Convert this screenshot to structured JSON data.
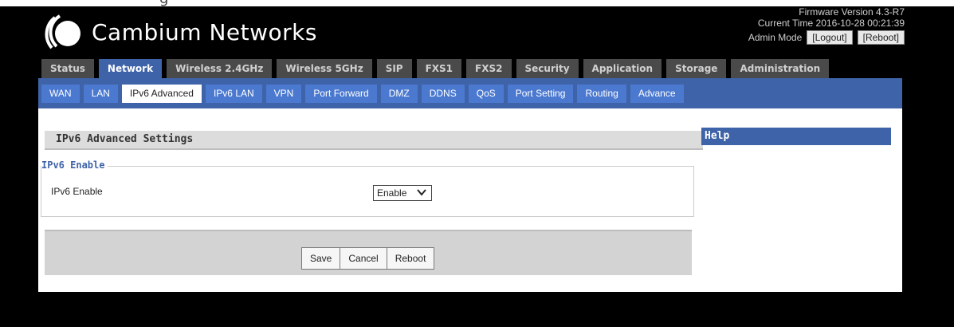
{
  "brand": {
    "name": "Cambium Networks"
  },
  "header": {
    "firmware": "Firmware Version 4.3-R7",
    "current_time": "Current Time 2016-10-28 00:21:39",
    "admin_mode": "Admin Mode",
    "logout": "[Logout]",
    "reboot": "[Reboot]"
  },
  "main_tabs": [
    {
      "label": "Status"
    },
    {
      "label": "Network"
    },
    {
      "label": "Wireless 2.4GHz"
    },
    {
      "label": "Wireless 5GHz"
    },
    {
      "label": "SIP"
    },
    {
      "label": "FXS1"
    },
    {
      "label": "FXS2"
    },
    {
      "label": "Security"
    },
    {
      "label": "Application"
    },
    {
      "label": "Storage"
    },
    {
      "label": "Administration"
    }
  ],
  "sub_tabs": [
    {
      "label": "WAN"
    },
    {
      "label": "LAN"
    },
    {
      "label": "IPv6 Advanced"
    },
    {
      "label": "IPv6 LAN"
    },
    {
      "label": "VPN"
    },
    {
      "label": "Port Forward"
    },
    {
      "label": "DMZ"
    },
    {
      "label": "DDNS"
    },
    {
      "label": "QoS"
    },
    {
      "label": "Port Setting"
    },
    {
      "label": "Routing"
    },
    {
      "label": "Advance"
    }
  ],
  "section": {
    "title": "IPv6 Advanced Settings",
    "legend": "IPv6 Enable",
    "field_label": "IPv6 Enable",
    "select_value": "Enable"
  },
  "actions": {
    "save": "Save",
    "cancel": "Cancel",
    "reboot": "Reboot"
  },
  "help": {
    "title": "Help"
  },
  "colors": {
    "accent": "#3e63a8",
    "subtab": "#4b79d0",
    "tab_inactive": "#4a4a4a",
    "background": "#000000"
  }
}
